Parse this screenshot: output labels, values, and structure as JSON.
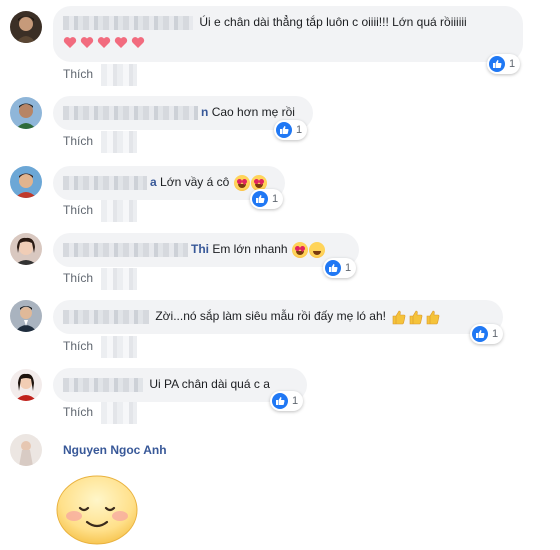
{
  "comments": [
    {
      "text": "Úi e chân dài thẳng tắp luôn c oiiii!!! Lớn quá rồiiiiii",
      "action": "Thích",
      "reaction_count": "1"
    },
    {
      "name_suffix": "n",
      "text": "Cao hơn mẹ rồi",
      "action": "Thích",
      "reaction_count": "1"
    },
    {
      "name_suffix": "a",
      "text": "Lớn vầy á cô",
      "action": "Thích",
      "reaction_count": "1"
    },
    {
      "name_suffix": "Thi",
      "text": "Em lớn nhanh",
      "action": "Thích",
      "reaction_count": "1"
    },
    {
      "text": "Zời...nó sắp làm siêu mẫu rồi đấy mẹ ló ah!",
      "action": "Thích",
      "reaction_count": "1"
    },
    {
      "text": "Ui PA chân dài quá c a",
      "action": "Thích",
      "reaction_count": "1"
    }
  ],
  "last_comment": {
    "name": "Nguyen Ngoc Anh"
  },
  "colors": {
    "name_blue": "#385898",
    "bubble_bg": "#f2f3f5",
    "like_blue": "#2078f4"
  }
}
